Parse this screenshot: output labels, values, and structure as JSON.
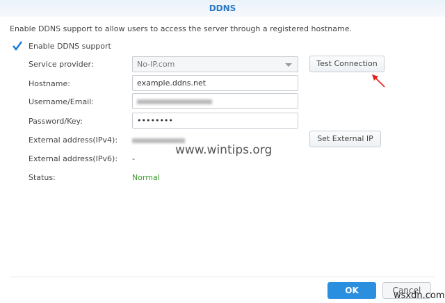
{
  "dialog": {
    "title": "DDNS",
    "description": "Enable DDNS support to allow users to access the server through a registered hostname."
  },
  "enable": {
    "label": "Enable DDNS support",
    "checked": true
  },
  "form": {
    "service_provider_label": "Service provider:",
    "service_provider_value": "No-IP.com",
    "hostname_label": "Hostname:",
    "hostname_value": "example.ddns.net",
    "username_label": "Username/Email:",
    "password_label": "Password/Key:",
    "password_value": "••••••••",
    "ipv4_label": "External address(IPv4):",
    "ipv6_label": "External address(IPv6):",
    "ipv6_value": "-",
    "status_label": "Status:",
    "status_value": "Normal"
  },
  "buttons": {
    "test": "Test Connection",
    "set_ip": "Set External IP",
    "ok": "OK",
    "cancel": "Cancel"
  },
  "watermarks": {
    "main": "www.wintips.org",
    "corner": "wsxdn.com"
  },
  "colors": {
    "accent": "#2b8fe0",
    "status": "#3a9a2a",
    "arrow": "#e0201e"
  }
}
